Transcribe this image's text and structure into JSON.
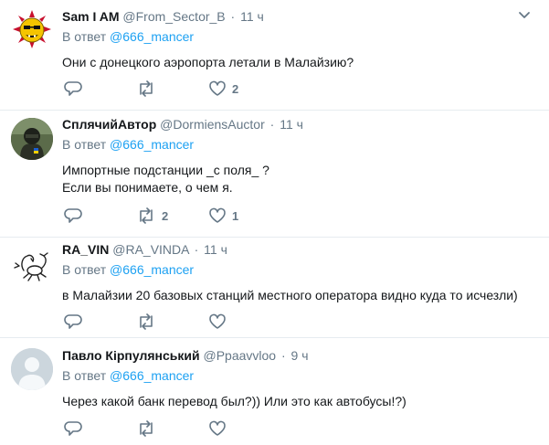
{
  "tweets": [
    {
      "name": "Sam I AM",
      "handle": "@From_Sector_B",
      "time": "11 ч",
      "reply_prefix": "В ответ",
      "reply_user": "@666_mancer",
      "text": [
        "Они с донецкого аэропорта летали в Малайзию?"
      ],
      "retweets": "",
      "likes": "2",
      "avatar": "serious-sam-bomb-avatar"
    },
    {
      "name": "СплячийАвтор",
      "handle": "@DormiensAuctor",
      "time": "11 ч",
      "reply_prefix": "В ответ",
      "reply_user": "@666_mancer",
      "text": [
        "Импортные подстанции _с поля_ ?",
        "Если вы понимаете, о чем я."
      ],
      "retweets": "2",
      "likes": "1",
      "avatar": "soldier-photo-avatar"
    },
    {
      "name": "RA_VIN",
      "handle": "@RA_VINDA",
      "time": "11 ч",
      "reply_prefix": "В ответ",
      "reply_user": "@666_mancer",
      "text": [
        "в Малайзии 20 базовых станций местного оператора видно куда то исчезли)"
      ],
      "retweets": "",
      "likes": "",
      "avatar": "scorpion-sketch-avatar"
    },
    {
      "name": "Павло Кірпулянський",
      "handle": "@Ppaavvloo",
      "time": "9 ч",
      "reply_prefix": "В ответ",
      "reply_user": "@666_mancer",
      "text": [
        "Через какой банк перевод был?)) Или это как автобусы!?)"
      ],
      "retweets": "",
      "likes": "",
      "avatar": "default-egg-avatar"
    }
  ],
  "colors": {
    "link": "#1da1f2",
    "muted": "#657786",
    "divider": "#e6ecf0",
    "text": "#14171a"
  }
}
